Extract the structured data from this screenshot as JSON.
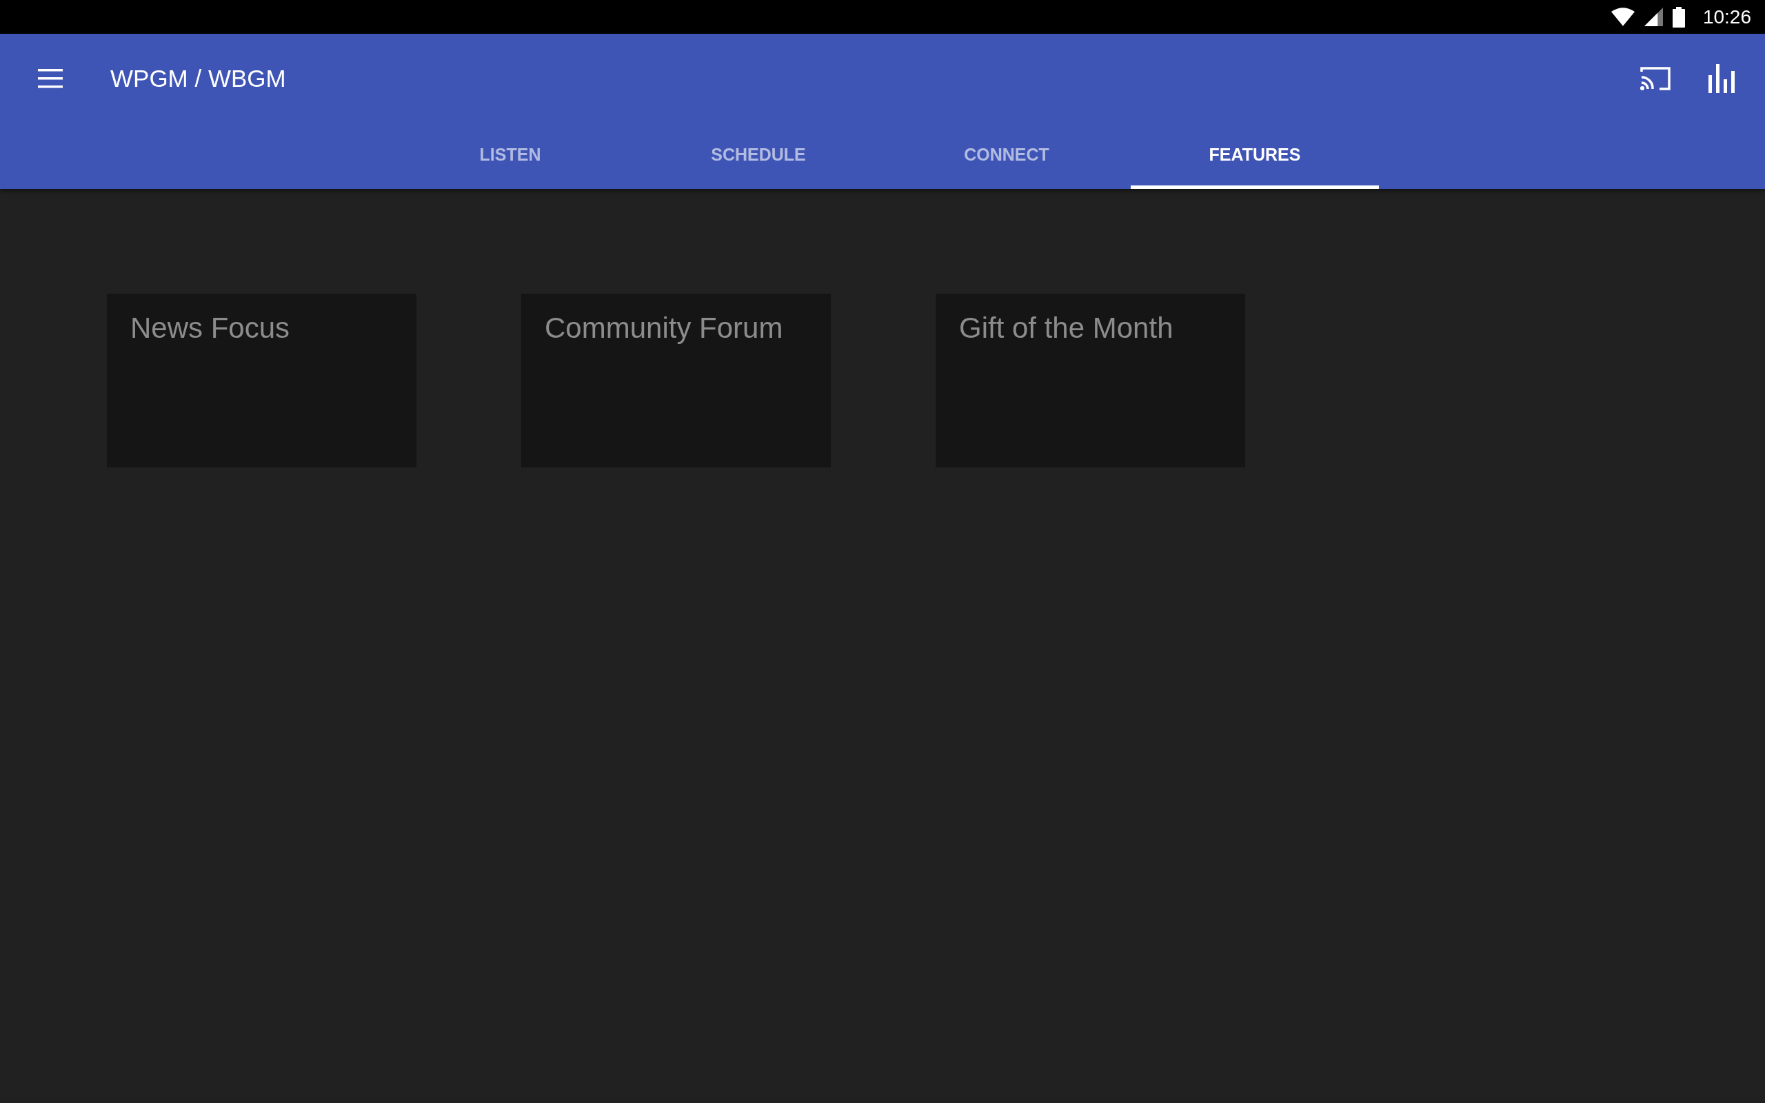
{
  "status_bar": {
    "time": "10:26"
  },
  "app_bar": {
    "title": "WPGM / WBGM"
  },
  "tabs": [
    {
      "label": "LISTEN",
      "selected": false
    },
    {
      "label": "SCHEDULE",
      "selected": false
    },
    {
      "label": "CONNECT",
      "selected": false
    },
    {
      "label": "FEATURES",
      "selected": true
    }
  ],
  "features": [
    {
      "title": "News Focus"
    },
    {
      "title": "Community Forum"
    },
    {
      "title": "Gift of the Month"
    }
  ]
}
